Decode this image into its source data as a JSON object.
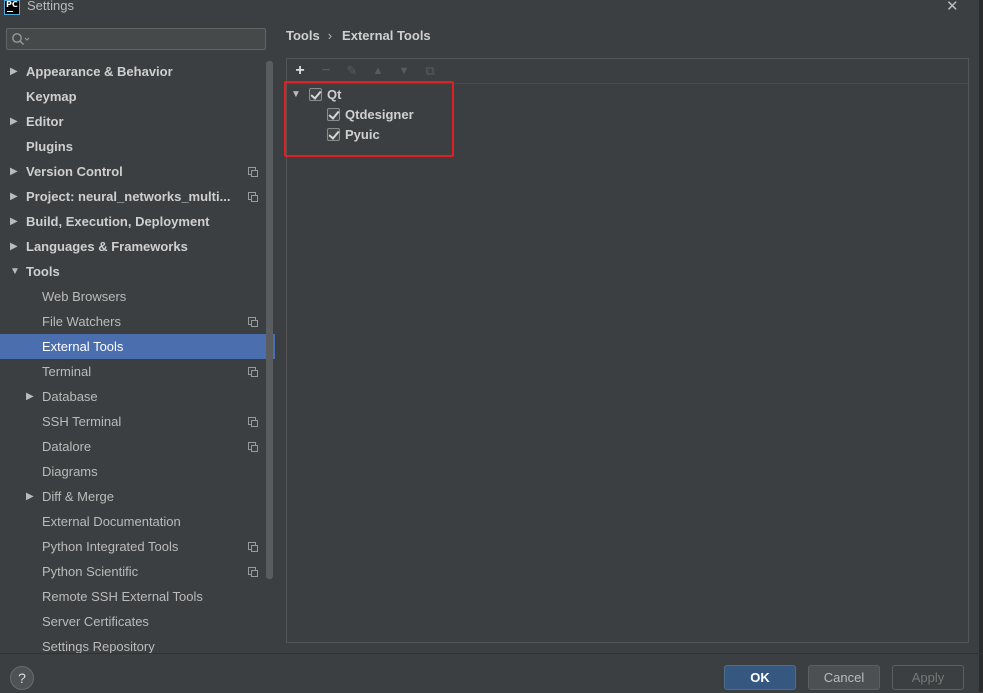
{
  "window": {
    "title": "Settings",
    "app_icon_text": "PC"
  },
  "search": {
    "placeholder": "",
    "value": ""
  },
  "sidebar": {
    "items": [
      {
        "label": "Appearance & Behavior",
        "level": 0,
        "expandable": true,
        "expanded": false,
        "bold": true,
        "copy": false
      },
      {
        "label": "Keymap",
        "level": 0,
        "expandable": false,
        "bold": true,
        "copy": false
      },
      {
        "label": "Editor",
        "level": 0,
        "expandable": true,
        "expanded": false,
        "bold": true,
        "copy": false
      },
      {
        "label": "Plugins",
        "level": 0,
        "expandable": false,
        "bold": true,
        "copy": false
      },
      {
        "label": "Version Control",
        "level": 0,
        "expandable": true,
        "expanded": false,
        "bold": true,
        "copy": true
      },
      {
        "label": "Project: neural_networks_multi...",
        "level": 0,
        "expandable": true,
        "expanded": false,
        "bold": true,
        "copy": true
      },
      {
        "label": "Build, Execution, Deployment",
        "level": 0,
        "expandable": true,
        "expanded": false,
        "bold": true,
        "copy": false
      },
      {
        "label": "Languages & Frameworks",
        "level": 0,
        "expandable": true,
        "expanded": false,
        "bold": true,
        "copy": false
      },
      {
        "label": "Tools",
        "level": 0,
        "expandable": true,
        "expanded": true,
        "bold": true,
        "copy": false
      },
      {
        "label": "Web Browsers",
        "level": 1,
        "expandable": false,
        "bold": false,
        "copy": false
      },
      {
        "label": "File Watchers",
        "level": 1,
        "expandable": false,
        "bold": false,
        "copy": true
      },
      {
        "label": "External Tools",
        "level": 1,
        "expandable": false,
        "bold": false,
        "copy": false,
        "selected": true
      },
      {
        "label": "Terminal",
        "level": 1,
        "expandable": false,
        "bold": false,
        "copy": true
      },
      {
        "label": "Database",
        "level": 1,
        "expandable": true,
        "expanded": false,
        "bold": false,
        "copy": false
      },
      {
        "label": "SSH Terminal",
        "level": 1,
        "expandable": false,
        "bold": false,
        "copy": true
      },
      {
        "label": "Datalore",
        "level": 1,
        "expandable": false,
        "bold": false,
        "copy": true
      },
      {
        "label": "Diagrams",
        "level": 1,
        "expandable": false,
        "bold": false,
        "copy": false
      },
      {
        "label": "Diff & Merge",
        "level": 1,
        "expandable": true,
        "expanded": false,
        "bold": false,
        "copy": false
      },
      {
        "label": "External Documentation",
        "level": 1,
        "expandable": false,
        "bold": false,
        "copy": false
      },
      {
        "label": "Python Integrated Tools",
        "level": 1,
        "expandable": false,
        "bold": false,
        "copy": true
      },
      {
        "label": "Python Scientific",
        "level": 1,
        "expandable": false,
        "bold": false,
        "copy": true
      },
      {
        "label": "Remote SSH External Tools",
        "level": 1,
        "expandable": false,
        "bold": false,
        "copy": false
      },
      {
        "label": "Server Certificates",
        "level": 1,
        "expandable": false,
        "bold": false,
        "copy": false
      },
      {
        "label": "Settings Repository",
        "level": 1,
        "expandable": false,
        "bold": false,
        "copy": false
      }
    ]
  },
  "breadcrumb": {
    "parent": "Tools",
    "separator": "›",
    "current": "External Tools"
  },
  "toolbar": {
    "add": "+",
    "remove": "−",
    "edit": "✎",
    "move_up": "▲",
    "move_down": "▼",
    "copy": "⧉"
  },
  "tools_tree": [
    {
      "label": "Qt",
      "level": 0,
      "checked": true,
      "expanded": true
    },
    {
      "label": "Qtdesigner",
      "level": 1,
      "checked": true
    },
    {
      "label": "Pyuic",
      "level": 1,
      "checked": true
    }
  ],
  "footer": {
    "help": "?",
    "ok": "OK",
    "cancel": "Cancel",
    "apply": "Apply"
  },
  "colors": {
    "selection": "#4b6eaf",
    "highlight_box": "#e02020",
    "ok_button": "#365880"
  }
}
